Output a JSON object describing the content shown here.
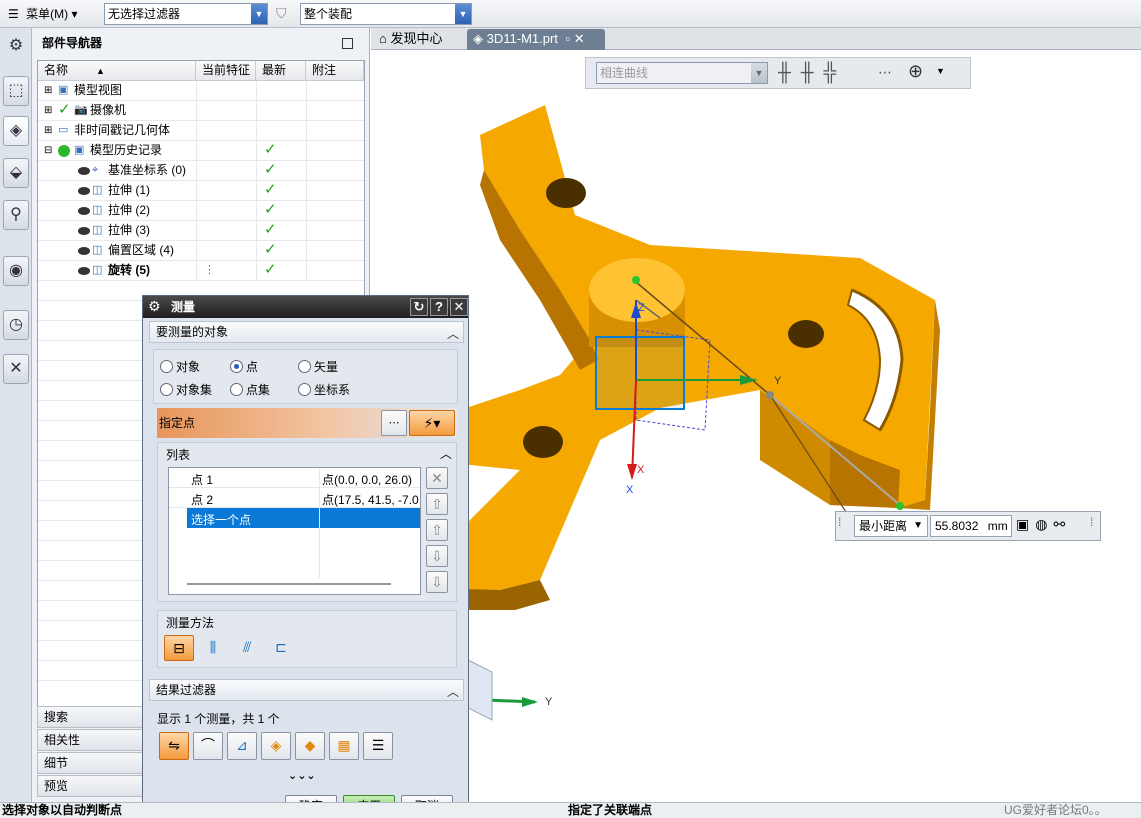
{
  "topbar": {
    "menu_label": "菜单(M)",
    "filter_value": "无选择过滤器",
    "assembly_value": "整个装配"
  },
  "navigator": {
    "title": "部件导航器",
    "columns": [
      "名称",
      "当前特征",
      "最新",
      "附注"
    ],
    "rows": [
      {
        "label": "模型视图",
        "latest": false
      },
      {
        "label": "摄像机",
        "latest": false
      },
      {
        "label": "非时间戳记几何体",
        "latest": false
      },
      {
        "label": "模型历史记录",
        "latest": true
      },
      {
        "label": "基准坐标系 (0)",
        "latest": true
      },
      {
        "label": "拉伸 (1)",
        "latest": true
      },
      {
        "label": "拉伸 (2)",
        "latest": true
      },
      {
        "label": "拉伸 (3)",
        "latest": true
      },
      {
        "label": "偏置区域 (4)",
        "latest": true
      },
      {
        "label": "旋转 (5)",
        "latest": true
      }
    ],
    "check_mark": "✓",
    "bottom_panels": [
      "搜索",
      "相关性",
      "细节",
      "预览"
    ]
  },
  "tabs": {
    "discovery": "发现中心",
    "file": "3D11-M1.prt"
  },
  "viewport_toolbar": {
    "curve_filter": "相连曲线"
  },
  "dialog": {
    "title": "测量",
    "section_objects": "要测量的对象",
    "options": [
      "对象",
      "点",
      "矢量",
      "对象集",
      "点集",
      "坐标系"
    ],
    "selected_option": "点",
    "specify_point": "指定点",
    "list_header": "列表",
    "list_rows": [
      {
        "name": "点 1",
        "value": "点(0.0, 0.0, 26.0)"
      },
      {
        "name": "点 2",
        "value": "点(17.5, 41.5, -7.0"
      },
      {
        "name": "选择一个点",
        "value": ""
      }
    ],
    "method_header": "测量方法",
    "result_filter_header": "结果过滤器",
    "result_text": "显示 1 个测量，共 1 个",
    "ok_label": "确定",
    "apply_label": "应用",
    "cancel_label": "取消"
  },
  "measurement": {
    "type": "最小距离",
    "value": "55.8032",
    "unit": "mm"
  },
  "axes": {
    "x": "X",
    "y": "Y",
    "z": "Z"
  },
  "status": {
    "left": "选择对象以自动判断点",
    "middle": "指定了关联端点",
    "watermark": "UG爱好者论坛0。。"
  },
  "colors": {
    "part_orange": "#f5a800",
    "part_dark": "#b87400",
    "selection_blue": "#0a7bd6",
    "active_orange": "#f39a3c"
  }
}
